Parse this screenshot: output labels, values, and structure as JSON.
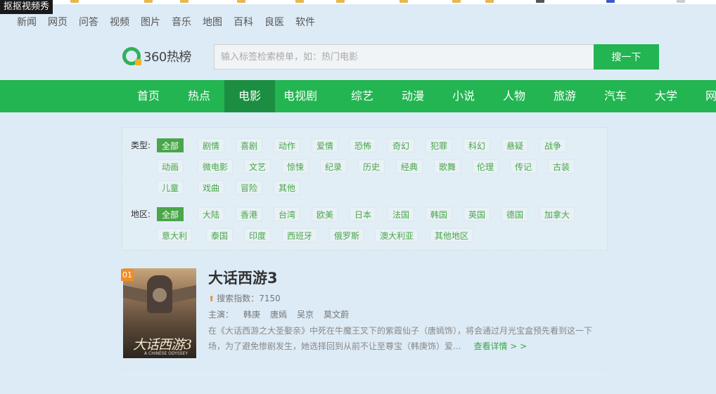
{
  "watermark": "抠抠视频秀",
  "top_nav": [
    "新闻",
    "网页",
    "问答",
    "视频",
    "图片",
    "音乐",
    "地图",
    "百科",
    "良医",
    "软件"
  ],
  "logo": {
    "text": "360热榜"
  },
  "search": {
    "placeholder": "输入标签检索榜单，如：热门电影",
    "value": "",
    "button": "搜一下"
  },
  "categories": [
    "首页",
    "热点",
    "电影",
    "电视剧",
    "综艺",
    "动漫",
    "小说",
    "人物",
    "旅游",
    "汽车",
    "大学",
    "网"
  ],
  "active_category": "电影",
  "filters": {
    "type_label": "类型:",
    "types": [
      "全部",
      "剧情",
      "喜剧",
      "动作",
      "爱情",
      "恐怖",
      "奇幻",
      "犯罪",
      "科幻",
      "悬疑",
      "战争",
      "动画",
      "微电影",
      "文艺",
      "惊悚",
      "纪录",
      "历史",
      "经典",
      "歌舞",
      "伦理",
      "传记",
      "古装",
      "儿童",
      "戏曲",
      "冒险",
      "其他"
    ],
    "region_label": "地区:",
    "regions": [
      "全部",
      "大陆",
      "香港",
      "台湾",
      "欧美",
      "日本",
      "法国",
      "韩国",
      "英国",
      "德国",
      "加拿大",
      "意大利",
      "泰国",
      "印度",
      "西班牙",
      "俄罗斯",
      "澳大利亚",
      "其他地区"
    ],
    "selected_type": "全部",
    "selected_region": "全部"
  },
  "result": {
    "rank": "01",
    "title": "大话西游3",
    "poster_title": "大话西游3",
    "poster_sub": "A CHINESE ODYSSEY",
    "search_index_label": "搜索指数：",
    "search_index": "7150",
    "cast_label": "主演：",
    "cast": [
      "韩庚",
      "唐嫣",
      "吴京",
      "莫文蔚"
    ],
    "description_line1": "在《大话西游之大圣娶亲》中死在牛魔王叉下的紫霞仙子（唐嫣饰），将会通过月光宝盒预先看到这一下",
    "description_line2": "场，为了避免惨剧发生，她选择回到从前不让至尊宝（韩庚饰）爱...",
    "detail_link": "查看详情 > >"
  },
  "colors": {
    "brand_green": "#22b551",
    "active_tab": "#1c8e42",
    "tag_green": "#4aa64a",
    "rank_orange": "#f28d23",
    "background": "#ddebf6"
  }
}
